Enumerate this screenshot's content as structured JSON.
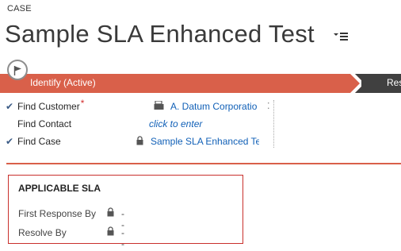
{
  "header": {
    "entity_label": "CASE",
    "record_title": "Sample SLA Enhanced Test"
  },
  "process": {
    "active_stage": "Identify (Active)",
    "next_stage": "Res",
    "bar_color": "#d9604a",
    "next_color": "#404040"
  },
  "fields": [
    {
      "label": "Find Customer",
      "checked": true,
      "required": true,
      "icon": "account-icon",
      "value": "A. Datum Corporatio"
    },
    {
      "label": "Find Contact",
      "checked": false,
      "required": false,
      "icon": "",
      "value": "click to enter"
    },
    {
      "label": "Find Case",
      "checked": true,
      "required": false,
      "icon": "lock-icon",
      "value": "Sample SLA Enhanced Tes"
    }
  ],
  "sla": {
    "title": "APPLICABLE SLA",
    "rows": [
      {
        "label": "First Response By",
        "value": "--"
      },
      {
        "label": "Resolve By",
        "value": "--"
      }
    ],
    "border_color": "#c9302c"
  },
  "colors": {
    "link": "#1160b7",
    "check": "#3b5b86",
    "required": "#d32f2f"
  }
}
